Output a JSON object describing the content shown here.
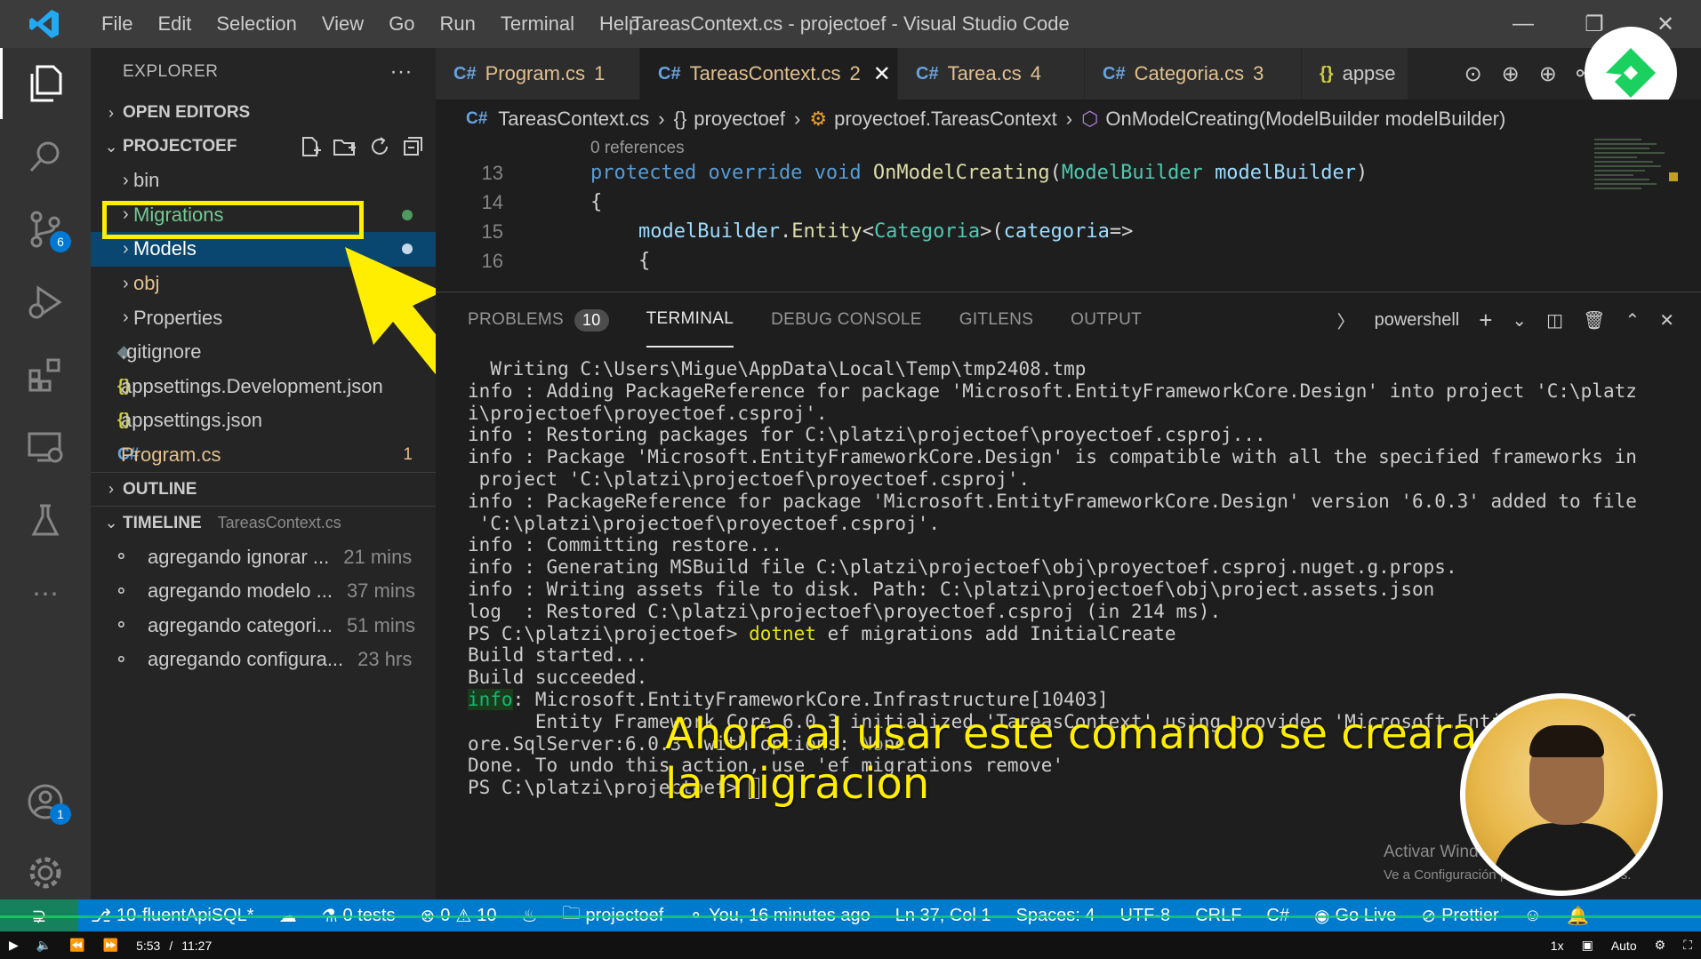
{
  "window": {
    "title": "TareasContext.cs - projectoef - Visual Studio Code",
    "menu": [
      "File",
      "Edit",
      "Selection",
      "View",
      "Go",
      "Run",
      "Terminal",
      "Help"
    ]
  },
  "activity_bar": {
    "source_control_badge": "6",
    "accounts_badge": "1"
  },
  "sidebar": {
    "header": "EXPLORER",
    "open_editors": "OPEN EDITORS",
    "project": "PROJECTOEF",
    "tree": [
      {
        "label": "bin",
        "type": "folder"
      },
      {
        "label": "Migrations",
        "type": "folder"
      },
      {
        "label": "Models",
        "type": "folder"
      },
      {
        "label": "obj",
        "type": "folder"
      },
      {
        "label": "Properties",
        "type": "folder"
      },
      {
        "label": ".gitignore",
        "type": "file"
      },
      {
        "label": "appsettings.Development.json",
        "type": "json"
      },
      {
        "label": "appsettings.json",
        "type": "json"
      },
      {
        "label": "Program.cs",
        "type": "cs",
        "count": "1"
      }
    ],
    "outline": "OUTLINE",
    "timeline": "TIMELINE",
    "timeline_file": "TareasContext.cs",
    "timeline_items": [
      {
        "label": "agregando ignorar ...",
        "time": "21 mins"
      },
      {
        "label": "agregando modelo ...",
        "time": "37 mins"
      },
      {
        "label": "agregando categori...",
        "time": "51 mins"
      },
      {
        "label": "agregando configura...",
        "time": "23 hrs"
      }
    ]
  },
  "tabs": [
    {
      "label": "Program.cs",
      "count": "1",
      "icon": "C#"
    },
    {
      "label": "TareasContext.cs",
      "count": "2",
      "icon": "C#",
      "active": true
    },
    {
      "label": "Tarea.cs",
      "count": "4",
      "icon": "C#"
    },
    {
      "label": "Categoria.cs",
      "count": "3",
      "icon": "C#"
    },
    {
      "label": "appse",
      "count": "",
      "icon": "{}"
    }
  ],
  "breadcrumb": {
    "file": "TareasContext.cs",
    "namespace": "proyectoef",
    "class": "proyectoef.TareasContext",
    "method": "OnModelCreating(ModelBuilder modelBuilder)",
    "braces": "{}"
  },
  "code": {
    "codelens": "0 references",
    "lines": [
      {
        "n": "13"
      },
      {
        "n": "14"
      },
      {
        "n": "15"
      },
      {
        "n": "16"
      }
    ]
  },
  "panel": {
    "tabs": [
      "PROBLEMS",
      "TERMINAL",
      "DEBUG CONSOLE",
      "GITLENS",
      "OUTPUT"
    ],
    "problems_count": "10",
    "shell": "powershell",
    "terminal_lines": [
      "  Writing C:\\Users\\Migue\\AppData\\Local\\Temp\\tmp2408.tmp",
      "info : Adding PackageReference for package 'Microsoft.EntityFrameworkCore.Design' into project 'C:\\platz",
      "i\\projectoef\\proyectoef.csproj'.",
      "info : Restoring packages for C:\\platzi\\projectoef\\proyectoef.csproj...",
      "info : Package 'Microsoft.EntityFrameworkCore.Design' is compatible with all the specified frameworks in",
      " project 'C:\\platzi\\projectoef\\proyectoef.csproj'.",
      "info : PackageReference for package 'Microsoft.EntityFrameworkCore.Design' version '6.0.3' added to file",
      " 'C:\\platzi\\projectoef\\proyectoef.csproj'.",
      "info : Committing restore...",
      "info : Generating MSBuild file C:\\platzi\\projectoef\\obj\\proyectoef.csproj.nuget.g.props.",
      "info : Writing assets file to disk. Path: C:\\platzi\\projectoef\\obj\\project.assets.json",
      "log  : Restored C:\\platzi\\projectoef\\proyectoef.csproj (in 214 ms)."
    ],
    "prompt1": "PS C:\\platzi\\projectoef> ",
    "cmd_dotnet": "dotnet",
    "cmd_rest": " ef migrations add InitialCreate",
    "build_started": "Build started...",
    "build_succeeded": "Build succeeded.",
    "info_word": "info",
    "info_line1": ": Microsoft.EntityFrameworkCore.Infrastructure[10403]",
    "info_line2": "      Entity Framework Core 6.0.3 initialized 'TareasContext' using provider 'Microsoft.EntityFrameworkC",
    "info_line3": "ore.SqlServer:6.0.3' with options: None",
    "done_line": "Done. To undo this action, use 'ef migrations remove'",
    "prompt2": "PS C:\\platzi\\projectoef> "
  },
  "caption": {
    "line1": "Ahora al usar este comando se creara",
    "line2": "la migracion"
  },
  "watermark": {
    "line1": "Activar Windows",
    "line2": "Ve a Configuración para activar Windows."
  },
  "statusbar": {
    "branch": "10-fluentApiSQL*",
    "tests": "0 tests",
    "errors": "0",
    "warnings": "10",
    "project": "projectoef",
    "blame": "You, 16 minutes ago",
    "position": "Ln 37, Col 1",
    "spaces": "Spaces: 4",
    "encoding": "UTF-8",
    "eol": "CRLF",
    "language": "C#",
    "golive": "Go Live",
    "prettier": "Prettier"
  },
  "player": {
    "current": "5:53",
    "sep": "/",
    "total": "11:27",
    "speed": "1x",
    "quality": "Auto"
  },
  "colors": {
    "accent": "#007acc",
    "highlight": "#ffee00",
    "selection": "#094771"
  }
}
